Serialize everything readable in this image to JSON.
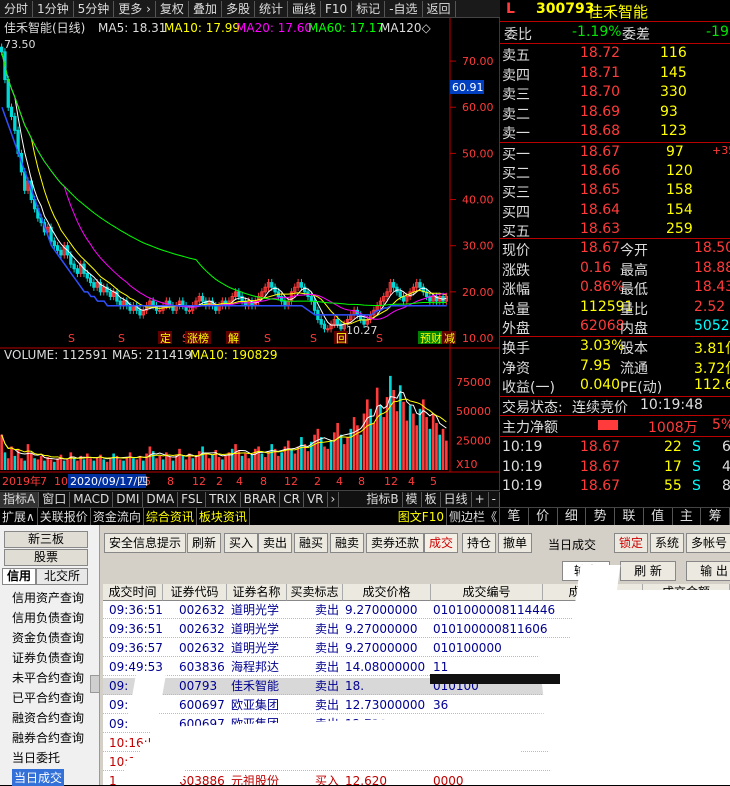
{
  "topbar": [
    "分时",
    "1分钟",
    "5分钟",
    "更多 ›",
    "复权",
    "叠加",
    "多股",
    "统计",
    "画线",
    "F10",
    "标记",
    "-自选",
    "返回"
  ],
  "chart": {
    "title": "佳禾智能(日线)",
    "ma5": "MA5: 18.31",
    "ma10": "MA10: 17.99",
    "ma20": "MA20: 17.60",
    "ma60": "MA60: 17.17",
    "ma120": "MA120◇",
    "price_ticks": [
      "70.00",
      "60.00",
      "50.00",
      "40.00",
      "30.00",
      "20.00",
      "10.00"
    ],
    "high_label": "73.50",
    "low_label": "10.27",
    "cursor_price": "60.91",
    "x_labels": [
      "2019年",
      "7",
      "10",
      "12",
      "3",
      "5",
      "8",
      "12",
      "2",
      "4",
      "8",
      "12",
      "2",
      "4",
      "8",
      "12",
      "4",
      "5"
    ],
    "date_label": "2020/09/17/四",
    "markers": [
      "S",
      "S",
      "S",
      "S",
      "定",
      "涨榜",
      "解",
      "S",
      "S",
      "回",
      "S",
      "预财",
      "减"
    ],
    "volume": {
      "label": "VOLUME: 112591",
      "ma5": "MA5: 211419",
      "ma10": "MA10: 190829",
      "ticks": [
        "75000",
        "50000",
        "25000"
      ],
      "unit": "X10"
    },
    "kline_series": [
      72,
      66,
      60,
      58,
      55,
      50,
      46,
      42,
      44,
      40,
      38,
      36,
      35,
      33,
      34,
      31,
      30,
      29,
      28,
      30,
      28,
      26,
      25,
      24,
      26,
      24,
      23,
      22,
      21,
      22,
      20,
      21,
      20,
      19,
      20,
      18,
      17,
      18,
      17,
      16,
      17,
      16,
      15,
      16,
      17,
      18,
      17,
      16,
      16,
      17,
      18,
      17,
      16,
      17,
      18,
      17,
      16,
      16,
      17,
      18,
      19,
      18,
      17,
      18,
      17,
      16,
      17,
      18,
      17,
      18,
      19,
      20,
      19,
      18,
      17,
      18,
      17,
      18,
      19,
      20,
      21,
      22,
      21,
      20,
      19,
      18,
      17,
      18,
      20,
      21,
      22,
      21,
      20,
      19,
      18,
      16,
      14,
      13,
      12,
      12,
      13,
      14,
      13,
      12,
      13,
      14,
      15,
      16,
      15,
      14,
      13,
      14,
      15,
      16,
      17,
      18,
      19,
      20,
      22,
      21,
      20,
      19,
      18,
      19,
      20,
      21,
      22,
      21,
      20,
      19,
      18,
      19,
      18,
      19,
      18,
      19
    ],
    "ma_long_series": [
      60,
      58,
      56,
      54,
      52,
      50,
      48,
      46,
      44,
      42,
      40,
      38,
      36,
      34,
      32,
      30,
      29,
      28,
      27,
      26,
      25,
      24,
      23,
      22,
      21,
      20,
      20,
      19,
      19,
      18,
      18,
      18,
      17,
      17,
      17,
      17,
      17,
      17,
      17,
      17,
      17,
      17,
      17,
      17,
      17,
      17,
      17,
      17,
      17,
      17,
      17,
      17,
      17,
      17,
      17,
      17,
      17,
      17,
      17,
      17,
      17,
      17,
      17,
      17,
      17,
      17,
      17,
      17,
      17,
      17,
      17,
      17,
      17,
      17,
      17,
      17,
      17,
      17,
      17,
      17,
      17,
      17,
      17,
      17,
      17,
      17,
      17,
      17,
      17,
      17,
      17,
      17,
      16.5,
      16,
      15.5,
      15,
      15,
      15,
      15,
      15,
      15,
      15,
      15,
      15,
      15,
      15,
      15,
      15,
      15,
      15,
      15,
      15,
      15,
      15.5,
      16,
      16,
      16.5,
      16.5,
      17,
      17,
      17,
      17,
      17,
      17,
      17,
      17,
      17,
      17,
      17,
      17,
      17,
      17,
      17,
      17,
      17,
      17
    ],
    "volume_series": [
      30,
      15,
      10,
      20,
      12,
      18,
      10,
      8,
      22,
      14,
      10,
      9,
      12,
      8,
      11,
      9,
      7,
      10,
      13,
      8,
      9,
      15,
      10,
      8,
      12,
      9,
      14,
      10,
      8,
      11,
      13,
      9,
      7,
      10,
      14,
      12,
      9,
      8,
      11,
      15,
      10,
      9,
      12,
      8,
      14,
      20,
      16,
      10,
      12,
      9,
      15,
      11,
      8,
      13,
      18,
      12,
      9,
      14,
      10,
      12,
      16,
      20,
      14,
      10,
      13,
      17,
      11,
      9,
      12,
      15,
      18,
      22,
      16,
      12,
      14,
      10,
      13,
      18,
      20,
      14,
      11,
      16,
      22,
      18,
      12,
      15,
      20,
      25,
      18,
      14,
      20,
      28,
      22,
      16,
      24,
      30,
      35,
      28,
      20,
      18,
      25,
      32,
      40,
      30,
      22,
      28,
      35,
      45,
      38,
      30,
      48,
      60,
      52,
      40,
      70,
      55,
      45,
      62,
      80,
      68,
      50,
      72,
      58,
      42,
      55,
      48,
      38,
      52,
      60,
      45,
      35,
      48,
      40,
      30,
      35,
      25
    ]
  },
  "indicator_tabs": [
    "指标A",
    "窗口",
    "MACD",
    "DMI",
    "DMA",
    "FSL",
    "TRIX",
    "BRAR",
    "CR",
    "VR",
    "›",
    "指标B",
    "模",
    "板",
    "日线",
    "+",
    "-"
  ],
  "sub_tabs": [
    "扩展∧",
    "关联报价",
    "资金流向",
    "综合资讯",
    "板块资讯",
    "图文F10",
    "侧边栏《"
  ],
  "quote": {
    "market": "L",
    "code": "300793",
    "name": "佳禾智能",
    "weibi_label": "委比",
    "weibi": "-1.19%",
    "weicha_label": "委差",
    "weicha": "-19",
    "asks": [
      {
        "label": "卖五",
        "price": "18.72",
        "vol": "116"
      },
      {
        "label": "卖四",
        "price": "18.71",
        "vol": "145"
      },
      {
        "label": "卖三",
        "price": "18.70",
        "vol": "330"
      },
      {
        "label": "卖二",
        "price": "18.69",
        "vol": "93"
      },
      {
        "label": "卖一",
        "price": "18.68",
        "vol": "123"
      }
    ],
    "bids": [
      {
        "label": "买一",
        "price": "18.67",
        "vol": "97",
        "extra": "+35"
      },
      {
        "label": "买二",
        "price": "18.66",
        "vol": "120"
      },
      {
        "label": "买三",
        "price": "18.65",
        "vol": "158"
      },
      {
        "label": "买四",
        "price": "18.64",
        "vol": "154"
      },
      {
        "label": "买五",
        "price": "18.63",
        "vol": "259"
      }
    ],
    "stats": [
      {
        "l1": "现价",
        "v1": "18.67",
        "l2": "今开",
        "v2": "18.50"
      },
      {
        "l1": "涨跌",
        "v1": "0.16",
        "l2": "最高",
        "v2": "18.88"
      },
      {
        "l1": "涨幅",
        "v1": "0.86%",
        "l2": "最低",
        "v2": "18.43"
      },
      {
        "l1": "总量",
        "v1": "112591",
        "l2": "量比",
        "v2": "2.52"
      },
      {
        "l1": "外盘",
        "v1": "62068",
        "l2": "内盘",
        "v2": "50523"
      }
    ],
    "stats2": [
      {
        "l1": "换手",
        "v1": "3.03%",
        "l2": "股本",
        "v2": "3.81亿"
      },
      {
        "l1": "净资",
        "v1": "7.95",
        "l2": "流通",
        "v2": "3.72亿"
      },
      {
        "l1": "收益(一)",
        "v1": "0.040",
        "l2": "PE(动)",
        "v2": "112.6"
      }
    ],
    "trade_state_label": "交易状态:",
    "trade_state": "连续竞价",
    "trade_time": "10:19:48",
    "net_label": "主力净额",
    "net_value": "1008万",
    "net_pct": "5%",
    "ticks": [
      {
        "t": "10:19",
        "p": "18.67",
        "v": "22",
        "s": "S",
        "n": "6"
      },
      {
        "t": "10:19",
        "p": "18.67",
        "v": "17",
        "s": "S",
        "n": "4"
      },
      {
        "t": "10:19",
        "p": "18.67",
        "v": "55",
        "s": "S",
        "n": "8"
      }
    ]
  },
  "quote_tabs": [
    "笔",
    "价",
    "细",
    "势",
    "联",
    "值",
    "主",
    "筹"
  ],
  "trade": {
    "tree_buttons": [
      "新三板",
      "股票"
    ],
    "tree_tabs": [
      "信用",
      "北交所"
    ],
    "tree_items": [
      "信用资产查询",
      "信用负债查询",
      "资金负债查询",
      "证券负债查询",
      "未平合约查询",
      "已平合约查询",
      "融资合约查询",
      "融券合约查询",
      "当日委托",
      "当日成交"
    ],
    "toolbar": [
      "安全信息提示",
      "刷新",
      "买入",
      "卖出",
      "融买",
      "融卖",
      "卖券还款",
      "成交",
      "持仓",
      "撤单"
    ],
    "view_title": "当日成交",
    "right_buttons": [
      "锁定",
      "系统",
      "多帐号"
    ],
    "action_buttons": [
      "输出",
      "刷 新",
      "输 出"
    ],
    "columns": [
      "成交时间",
      "证券代码",
      "证券名称",
      "买卖标志",
      "成交价格",
      "成交编号",
      "成交数量",
      "成交金额"
    ],
    "rows": [
      {
        "time": "09:36:51",
        "code": "002632",
        "name": "道明光学",
        "side": "卖出",
        "price": "9.27000000",
        "no": "0101000008114446"
      },
      {
        "time": "09:36:51",
        "code": "002632",
        "name": "道明光学",
        "side": "卖出",
        "price": "9.27000000",
        "no": "010100000811606"
      },
      {
        "time": "09:36:57",
        "code": "002632",
        "name": "道明光学",
        "side": "卖出",
        "price": "9.27000000",
        "no": "010100000"
      },
      {
        "time": "09:49:53",
        "code": "603836",
        "name": "海程邦达",
        "side": "卖出",
        "price": "14.08000000",
        "no": "11"
      },
      {
        "time": "09:",
        "code": "00793",
        "name": "佳禾智能",
        "side": "卖出",
        "price": "18.",
        "no": "010100"
      },
      {
        "time": "09:",
        "code": "600697",
        "name": "欧亚集团",
        "side": "卖出",
        "price": "12.73000000",
        "no": "36"
      },
      {
        "time": "09:",
        "code": "600697",
        "name": "欧亚集团",
        "side": "卖出",
        "price": "12.73000000",
        "no": ""
      },
      {
        "time": "10:16:56",
        "code": "",
        "name": "",
        "side": "",
        "price": "",
        "no": ""
      },
      {
        "time": "10:1",
        "code": "",
        "name": "",
        "side": "",
        "price": "",
        "no": ""
      },
      {
        "time": "1",
        "code": "603886",
        "name": "元祖股份",
        "side": "买入",
        "price": "12.620",
        "no": "0000"
      }
    ]
  }
}
